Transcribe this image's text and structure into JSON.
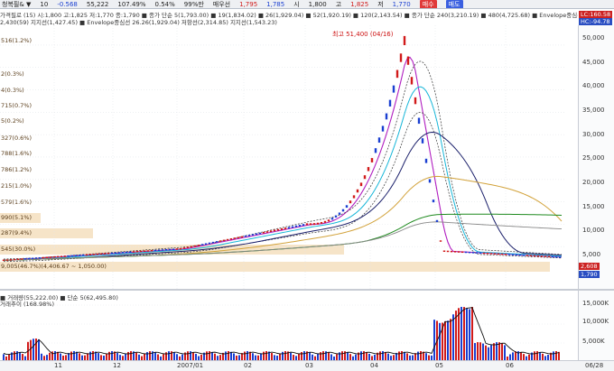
{
  "topbar": {
    "fields": [
      "청복필& ▼",
      "10",
      "-0.568",
      "55,222",
      "107.49%",
      "0.54%",
      "99%만",
      "매우선",
      "1,795",
      "1,785",
      "시",
      "1,800",
      "고",
      "1,825",
      "저",
      "1,770"
    ],
    "buy_label": "매수",
    "sell_label": "매도"
  },
  "legend": {
    "line1": "가격필로 (15)   시:1,800 고:1,825 저:1,770 종:1,790   ■ 종가 단순 5(1,793.00)  ■ 19(1,834.02)  ■ 26(1,929.04)  ■ 52(1,920.19)  ■ 120(2,143.54)  ■ 종가 단순 240(3,210.19)  ■ 480(4,725.68)  ■ Envelope중심선 26.26(1,929.04)",
    "line2": "2,430(59)  지지선(1,427.45)   ■ Envelope중심선 26.26(1,929.04)   저항선(2,314.85)   지지선(1,543.23)"
  },
  "annotation": {
    "peak_label": "최고 51,400 (04/16)"
  },
  "price_axis": [
    "50,000",
    "45,000",
    "40,000",
    "35,000",
    "30,000",
    "25,000",
    "20,000",
    "15,000",
    "10,000",
    "5,000"
  ],
  "price_tags": {
    "top1": "LC:160.58",
    "top2": "HC:-94.78",
    "last": "2,608",
    "sub": "1,790"
  },
  "levels": [
    "516(1.2%)",
    "2(0.3%)",
    "4(0.3%)",
    "715(0.7%)",
    "5(0.2%)",
    "327(0.6%)",
    "788(1.6%)",
    "786(1.2%)",
    "215(1.0%)",
    "579(1.6%)",
    "990(5.1%)",
    "287(9.4%)",
    "545(30.0%)",
    "9,005(46.7%)(4,406.67 ~ 1,050.00)"
  ],
  "volume": {
    "legend1": "■ 거래량(55,222.00)  ■ 단순 5(62,495.80)",
    "legend2": "거래추이 (168.98%)",
    "axis": [
      "15,000K",
      "10,000K",
      "5,000K"
    ]
  },
  "xaxis": [
    "11",
    "12",
    "2007/01",
    "02",
    "03",
    "04",
    "05",
    "06",
    "06/28"
  ],
  "colors": {
    "up": "#d11a1a",
    "down": "#1a3fd1",
    "bg": "#ffffff"
  },
  "chart_data": {
    "type": "line",
    "title": "",
    "x": [
      "11",
      "12",
      "2007/01",
      "02",
      "03",
      "04",
      "05",
      "06",
      "06/28"
    ],
    "series": [
      {
        "values": [
          1900,
          3000,
          4800,
          6000,
          11000,
          47000,
          4000,
          2800,
          2600
        ]
      }
    ],
    "ylim": [
      0,
      52000
    ]
  }
}
